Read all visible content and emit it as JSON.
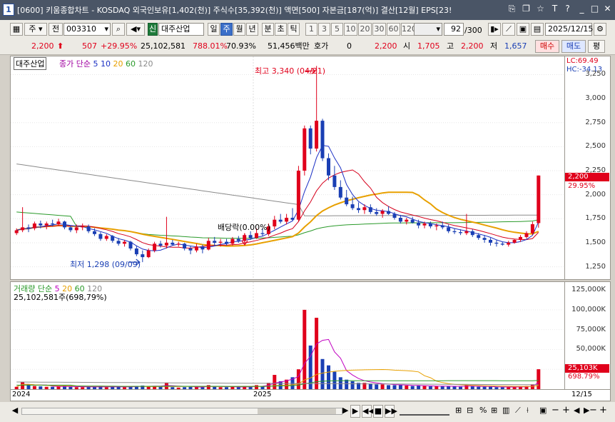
{
  "window": {
    "number": "1",
    "title": "[0600] 키움종합차트 - KOSDAQ 외국인보유[1,402(천)] 주식수[35,392(천)] 액면[500] 자본금[187(억)] 결산[12월] EPS[23!"
  },
  "toolbar": {
    "type_label": "주",
    "prev_label": "전",
    "code": "003310",
    "stock_badge": "신",
    "stock_name": "대주산업",
    "periods": [
      "일",
      "주",
      "월",
      "년",
      "분",
      "초",
      "틱"
    ],
    "selected_period": "주",
    "intervals": [
      "1",
      "3",
      "5",
      "10",
      "20",
      "30",
      "60",
      "120"
    ],
    "count_value": "92",
    "count_total": "/300",
    "date": "2025/12/15"
  },
  "quote": {
    "price": "2,200",
    "change": "507",
    "change_rate": "+29.95%",
    "volume": "25,102,581",
    "volume_rate": "788.01%",
    "ratio": "70.93%",
    "amount": "51,456백만",
    "hoga_label": "호가",
    "hoga_value": "0",
    "hoga_price": "2,200",
    "open_label": "시",
    "open": "1,705",
    "high_label": "고",
    "high": "2,200",
    "low_label": "저",
    "low": "1,657",
    "buy_label": "매수",
    "sell_label": "매도",
    "eval_label": "평"
  },
  "legend": {
    "stock_name": "대주산업",
    "ma_title": "종가 단순",
    "ma_periods": [
      "5",
      "10",
      "20",
      "60",
      "120"
    ],
    "vol_title": "거래량 단순",
    "vol_periods": [
      "5",
      "20",
      "60",
      "120"
    ],
    "vol_readout": "25,102,581주(698,79%)"
  },
  "annotations": {
    "high": "최고 3,340 (04/21)",
    "low": "최저 1,298 (09/09)",
    "dividend": "배당락(0.00%)",
    "lc": "LC:69.49",
    "hc": "HC:-34.13",
    "price_tag": "2,200",
    "price_pct": "29.95%",
    "vol_tag": "25,103K",
    "vol_pct": "698.79%"
  },
  "colors": {
    "up": "#e0001b",
    "down": "#1a3fb4",
    "ma5": "#1a2fc4",
    "ma10": "#d6001c",
    "ma20": "#e8a000",
    "ma60": "#2a9a2a",
    "ma120": "#8a8a8a",
    "vma5": "#c000c0"
  },
  "chart_data": {
    "type": "candlestick",
    "title": "",
    "date_labels": [
      "2024",
      "2025",
      "12/15"
    ],
    "price_ticks": [
      "3,250",
      "3,000",
      "2,750",
      "2,500",
      "2,250",
      "2,000",
      "1,750",
      "1,500",
      "1,250"
    ],
    "volume_ticks": [
      "125,000K",
      "100,000K",
      "75,000K",
      "50,000K"
    ],
    "ylim": [
      1180,
      3380
    ],
    "vlim": [
      0,
      126000
    ],
    "candles": [
      [
        1600,
        1650,
        1580,
        1630,
        3000
      ],
      [
        1630,
        1870,
        1610,
        1660,
        9000
      ],
      [
        1660,
        1690,
        1610,
        1650,
        6000
      ],
      [
        1650,
        1720,
        1630,
        1700,
        4000
      ],
      [
        1700,
        1730,
        1650,
        1680,
        3500
      ],
      [
        1680,
        1720,
        1640,
        1700,
        3000
      ],
      [
        1700,
        1740,
        1670,
        1690,
        3000
      ],
      [
        1690,
        1750,
        1680,
        1720,
        3500
      ],
      [
        1720,
        1730,
        1640,
        1660,
        4000
      ],
      [
        1660,
        1680,
        1610,
        1630,
        3000
      ],
      [
        1630,
        1690,
        1600,
        1660,
        2500
      ],
      [
        1660,
        1700,
        1630,
        1670,
        2500
      ],
      [
        1670,
        1690,
        1600,
        1620,
        3000
      ],
      [
        1620,
        1650,
        1570,
        1590,
        3000
      ],
      [
        1590,
        1610,
        1520,
        1540,
        3500
      ],
      [
        1540,
        1590,
        1520,
        1570,
        2500
      ],
      [
        1570,
        1580,
        1500,
        1520,
        3000
      ],
      [
        1520,
        1550,
        1470,
        1490,
        3000
      ],
      [
        1490,
        1530,
        1460,
        1510,
        2500
      ],
      [
        1510,
        1520,
        1420,
        1440,
        3500
      ],
      [
        1440,
        1470,
        1360,
        1380,
        4000
      ],
      [
        1380,
        1420,
        1298,
        1350,
        4500
      ],
      [
        1350,
        1440,
        1340,
        1420,
        3500
      ],
      [
        1420,
        1510,
        1400,
        1490,
        4000
      ],
      [
        1490,
        1520,
        1450,
        1470,
        3000
      ],
      [
        1470,
        1770,
        1440,
        1500,
        8000
      ],
      [
        1500,
        1530,
        1470,
        1480,
        2500
      ],
      [
        1480,
        1510,
        1460,
        1490,
        2000
      ],
      [
        1490,
        1500,
        1420,
        1440,
        2500
      ],
      [
        1440,
        1470,
        1380,
        1420,
        3000
      ],
      [
        1420,
        1490,
        1400,
        1460,
        3500
      ],
      [
        1460,
        1480,
        1390,
        1430,
        2500
      ],
      [
        1430,
        1550,
        1420,
        1520,
        5000
      ],
      [
        1520,
        1560,
        1470,
        1500,
        3000
      ],
      [
        1500,
        1540,
        1460,
        1510,
        2500
      ],
      [
        1510,
        1540,
        1470,
        1490,
        2500
      ],
      [
        1490,
        1560,
        1470,
        1540,
        3000
      ],
      [
        1540,
        1570,
        1500,
        1520,
        2500
      ],
      [
        1520,
        1600,
        1510,
        1580,
        4000
      ],
      [
        1580,
        1620,
        1530,
        1550,
        3000
      ],
      [
        1550,
        1650,
        1540,
        1600,
        5000
      ],
      [
        1600,
        1650,
        1570,
        1590,
        4000
      ],
      [
        1590,
        1700,
        1570,
        1670,
        8000
      ],
      [
        1670,
        1780,
        1640,
        1740,
        18000
      ],
      [
        1740,
        1800,
        1700,
        1720,
        10000
      ],
      [
        1720,
        1800,
        1690,
        1760,
        12000
      ],
      [
        1760,
        1860,
        1730,
        1740,
        15000
      ],
      [
        1740,
        2300,
        1720,
        2250,
        25000
      ],
      [
        2250,
        2720,
        2200,
        2690,
        100000
      ],
      [
        2690,
        2720,
        2420,
        2480,
        55000
      ],
      [
        2480,
        3340,
        2450,
        2770,
        90000
      ],
      [
        2770,
        2790,
        2350,
        2380,
        38000
      ],
      [
        2380,
        2430,
        2150,
        2200,
        30000
      ],
      [
        2200,
        2300,
        2050,
        2080,
        22000
      ],
      [
        2080,
        2150,
        1950,
        1970,
        15000
      ],
      [
        1970,
        2050,
        1880,
        1900,
        12000
      ],
      [
        1900,
        1980,
        1840,
        1860,
        10000
      ],
      [
        1860,
        1920,
        1810,
        1840,
        8000
      ],
      [
        1840,
        1900,
        1800,
        1870,
        8000
      ],
      [
        1870,
        1900,
        1800,
        1820,
        7000
      ],
      [
        1820,
        1860,
        1780,
        1800,
        6000
      ],
      [
        1800,
        1850,
        1760,
        1830,
        6000
      ],
      [
        1830,
        1880,
        1790,
        1800,
        5000
      ],
      [
        1800,
        1820,
        1740,
        1760,
        5000
      ],
      [
        1760,
        1790,
        1700,
        1720,
        5000
      ],
      [
        1720,
        1760,
        1690,
        1740,
        4500
      ],
      [
        1740,
        1770,
        1700,
        1710,
        4000
      ],
      [
        1710,
        1740,
        1650,
        1680,
        4500
      ],
      [
        1680,
        1720,
        1650,
        1700,
        4000
      ],
      [
        1700,
        1720,
        1650,
        1670,
        3500
      ],
      [
        1670,
        1700,
        1630,
        1680,
        3500
      ],
      [
        1680,
        1720,
        1640,
        1660,
        3500
      ],
      [
        1660,
        1690,
        1600,
        1620,
        4000
      ],
      [
        1620,
        1650,
        1590,
        1610,
        3500
      ],
      [
        1610,
        1640,
        1580,
        1600,
        3000
      ],
      [
        1600,
        1800,
        1580,
        1620,
        5000
      ],
      [
        1620,
        1640,
        1560,
        1580,
        3500
      ],
      [
        1580,
        1600,
        1530,
        1550,
        3000
      ],
      [
        1550,
        1580,
        1500,
        1530,
        3000
      ],
      [
        1530,
        1550,
        1470,
        1500,
        3000
      ],
      [
        1500,
        1530,
        1460,
        1490,
        2500
      ],
      [
        1490,
        1510,
        1470,
        1480,
        2500
      ],
      [
        1480,
        1520,
        1460,
        1500,
        2500
      ],
      [
        1500,
        1540,
        1490,
        1530,
        3000
      ],
      [
        1530,
        1580,
        1510,
        1560,
        3500
      ],
      [
        1560,
        1620,
        1540,
        1600,
        4000
      ],
      [
        1600,
        1720,
        1580,
        1693,
        6000
      ],
      [
        1705,
        2200,
        1657,
        2200,
        25103
      ]
    ]
  }
}
